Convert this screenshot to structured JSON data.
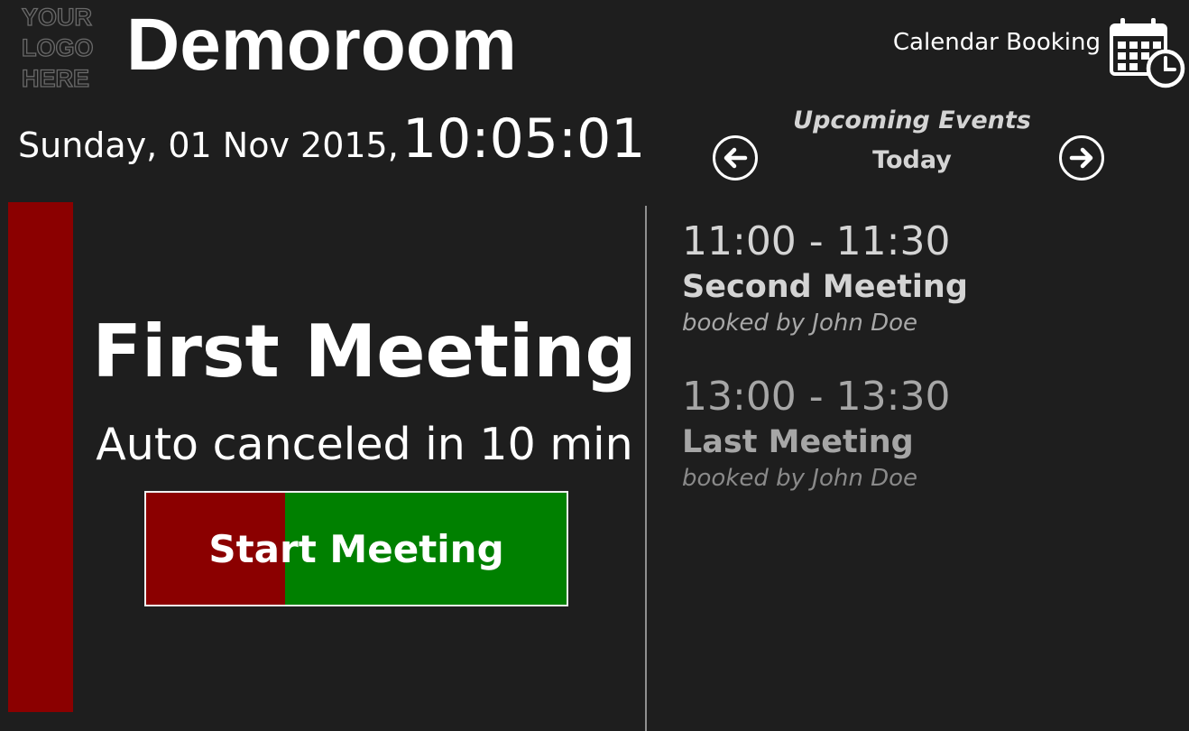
{
  "logo": {
    "lines": [
      "YOUR",
      "LOGO",
      "HERE"
    ]
  },
  "room": {
    "name": "Demoroom"
  },
  "header": {
    "booking_label": "Calendar Booking",
    "booking_icon": "calendar-clock-icon"
  },
  "clock": {
    "date": "Sunday, 01 Nov 2015,",
    "time": "10:05:01"
  },
  "upcoming": {
    "title": "Upcoming Events",
    "day": "Today",
    "prev_icon": "arrow-left-circle-icon",
    "next_icon": "arrow-right-circle-icon"
  },
  "current": {
    "status_color": "#8b0000",
    "title": "First Meeting",
    "auto_cancel": "Auto canceled in 10 min",
    "start_button": {
      "label": "Start Meeting",
      "progress_fraction": 0.33,
      "progress_color": "#8b0000",
      "button_color": "#008000"
    }
  },
  "events": [
    {
      "time": "11:00 - 11:30",
      "title": "Second Meeting",
      "booked_by": "booked by John Doe"
    },
    {
      "time": "13:00 - 13:30",
      "title": "Last Meeting",
      "booked_by": "booked by John Doe"
    }
  ]
}
